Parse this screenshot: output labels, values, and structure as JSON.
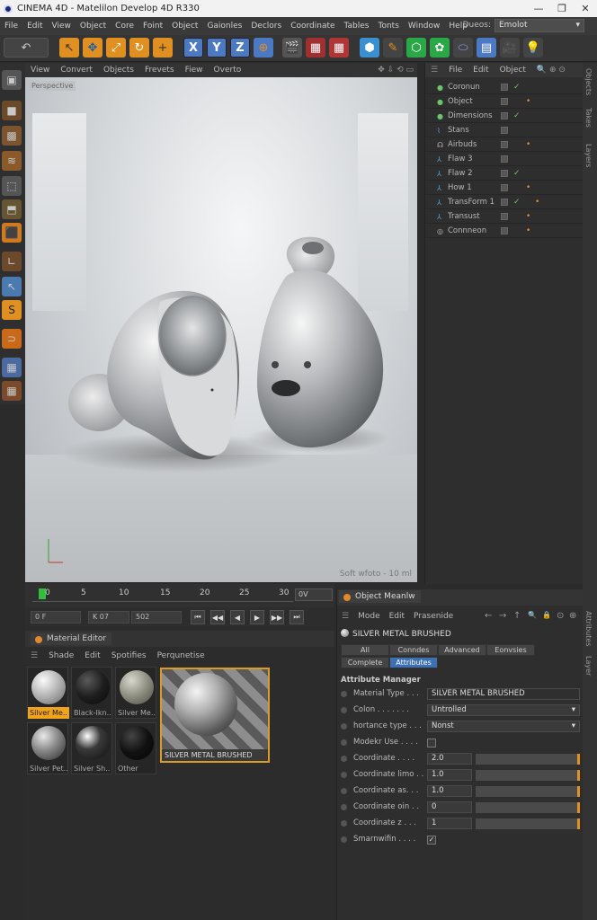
{
  "window": {
    "title": "CINEMA 4D - Matelilon Develop 4D R330",
    "controls": [
      "—",
      "❐",
      "✕"
    ]
  },
  "menubar": {
    "items": [
      "File",
      "Edit",
      "View",
      "Object",
      "Core",
      "Foint",
      "Object",
      "Gaionles",
      "Declors",
      "Coordinate",
      "Tables",
      "Tonts",
      "Window",
      "Help"
    ],
    "layout_label": "Dueos:",
    "layout_value": "Emolot"
  },
  "toolbar": {
    "icons": [
      "undo-icon",
      "select-icon",
      "move-icon",
      "scale-icon",
      "rotate-icon",
      "add-icon",
      "x-axis-icon",
      "y-axis-icon",
      "z-axis-icon",
      "coordinate-icon",
      "clapper-icon",
      "render-settings-icon",
      "render-icon",
      "cube-icon",
      "pen-icon",
      "subdivision-icon",
      "cloner-icon",
      "deformer-icon",
      "floor-icon",
      "camera-icon",
      "light-icon"
    ],
    "axis_labels": [
      "X",
      "Y",
      "Z"
    ]
  },
  "viewport": {
    "menu": [
      "View",
      "Convert",
      "Objects",
      "Frevets",
      "Fiew",
      "Overto"
    ],
    "label_topleft": "Perspective",
    "label_bottomright": "Soft wfoto - 10 ml"
  },
  "object_manager": {
    "menu": [
      "File",
      "Edit",
      "Object"
    ],
    "objects": [
      {
        "name": "Coronun",
        "icon_color": "#6cc36c",
        "tag": ""
      },
      {
        "name": "Object",
        "icon_color": "#6cc36c",
        "tag": "•"
      },
      {
        "name": "Dimensions",
        "icon_color": "#6cc36c",
        "tag": ""
      },
      {
        "name": "Stans",
        "icon_color": "#5aa0d8",
        "tag": ""
      },
      {
        "name": "Airbuds",
        "icon_color": "#bbbbbb",
        "tag": "•"
      },
      {
        "name": "Flaw 3",
        "icon_color": "#5aa0d8",
        "tag": ""
      },
      {
        "name": "Flaw 2",
        "icon_color": "#5aa0d8",
        "tag": ""
      },
      {
        "name": "How 1",
        "icon_color": "#5aa0d8",
        "tag": "•"
      },
      {
        "name": "TransForm 1",
        "icon_color": "#5aa0d8",
        "tag": "•"
      },
      {
        "name": "Transust",
        "icon_color": "#5aa0d8",
        "tag": "•"
      },
      {
        "name": "Connneon",
        "icon_color": "#bbbbbb",
        "tag": "•"
      }
    ],
    "side_tabs": [
      "Objects",
      "Takes",
      "Layers"
    ]
  },
  "timeline": {
    "ticks": [
      "0",
      "5",
      "10",
      "15",
      "20",
      "25",
      "30"
    ],
    "current_frame": "0V",
    "start_field": "0 F",
    "mid_field": "K 07",
    "end_field": "502",
    "transport": [
      "⏮",
      "◀◀",
      "◀",
      "▶",
      "▶▶",
      "⏭"
    ]
  },
  "material_editor": {
    "tab": "Material Editor",
    "menu": [
      "Shade",
      "Edit",
      "Spotifies",
      "Perqunetise"
    ],
    "materials": [
      {
        "name": "Silver Me..",
        "selected": true
      },
      {
        "name": "Black-Ikn..",
        "selected": false
      },
      {
        "name": "Silver Me..",
        "selected": false
      },
      {
        "name": "Silver Pet..",
        "selected": false
      },
      {
        "name": "Silver Sh..",
        "selected": false
      },
      {
        "name": "Other",
        "selected": false
      }
    ],
    "preview_name": "SILVER METAL BRUSHED"
  },
  "attribute_manager": {
    "tab": "Object Meanlw",
    "menu": [
      "Mode",
      "Edit",
      "Prasenide"
    ],
    "nav_icons": [
      "←",
      "→",
      "↑",
      "🔍",
      "🔒",
      "⊙",
      "⊕"
    ],
    "object_name": "SILVER METAL BRUSHED",
    "tabs_row1": [
      "All",
      "Conndes",
      "Advanced",
      "Eonvsies"
    ],
    "tabs_row2": [
      "Complete",
      "Attributes"
    ],
    "active_tab": "Attributes",
    "section": "Attribute Manager",
    "fields": [
      {
        "label": "Material Type . . .",
        "value": "SILVER METAL BRUSHED",
        "kind": "text"
      },
      {
        "label": "Colon . . . . . . .",
        "value": "Untrolled",
        "kind": "dropdown"
      },
      {
        "label": "hortance type . . .",
        "value": "Nonst",
        "kind": "dropdown"
      },
      {
        "label": "Modekr Use . . . .",
        "value": "",
        "kind": "checkbox"
      },
      {
        "label": "Coordinate . . . .",
        "value": "2.0",
        "kind": "number"
      },
      {
        "label": "Coordinate limo . .",
        "value": "1.0",
        "kind": "number"
      },
      {
        "label": "Coordinate as. . .",
        "value": "1.0",
        "kind": "number"
      },
      {
        "label": "Coordinate oin . .",
        "value": "0",
        "kind": "number"
      },
      {
        "label": "Coordinate z . . .",
        "value": "1",
        "kind": "number"
      },
      {
        "label": "Smarnwifin . . . .",
        "value": "✓",
        "kind": "checkbox"
      }
    ],
    "side_tabs": [
      "Attributes",
      "Layer"
    ]
  }
}
